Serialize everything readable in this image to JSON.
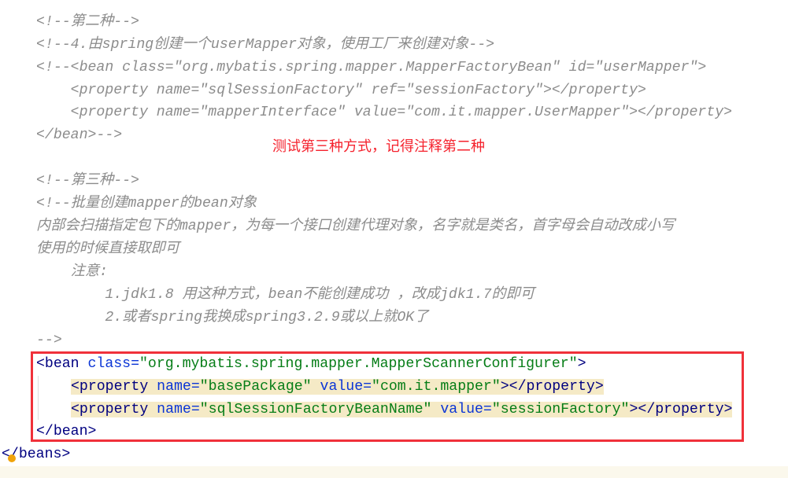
{
  "comment_lines": [
    "<!--第二种-->",
    "<!--4.由spring创建一个userMapper对象，使用工厂来创建对象-->",
    "<!--<bean class=\"org.mybatis.spring.mapper.MapperFactoryBean\" id=\"userMapper\">",
    "    <property name=\"sqlSessionFactory\" ref=\"sessionFactory\"></property>",
    "    <property name=\"mapperInterface\" value=\"com.it.mapper.UserMapper\"></property>",
    "</bean>-->",
    "",
    "<!--第三种-->",
    "<!--批量创建mapper的bean对象",
    "内部会扫描指定包下的mapper，为每一个接口创建代理对象，名字就是类名，首字母会自动改成小写",
    "使用的时候直接取即可",
    "    注意:",
    "        1.jdk1.8 用这种方式，bean不能创建成功 ，改成jdk1.7的即可",
    "        2.或者spring我换成spring3.2.9或以上就OK了",
    "-->"
  ],
  "annotation": "测试第三种方式，记得注释第二种",
  "bean": {
    "open": "<bean",
    "class_attr": "class=",
    "class_val": "\"org.mybatis.spring.mapper.MapperScannerConfigurer\"",
    "close_open": ">",
    "properties": [
      {
        "name_val": "\"basePackage\"",
        "value_val": "\"com.it.mapper\""
      },
      {
        "name_val": "\"sqlSessionFactoryBeanName\"",
        "value_val": "\"sessionFactory\""
      }
    ],
    "prop_open": "<property",
    "name_attr": "name=",
    "value_attr": "value=",
    "prop_close": "></property>",
    "end": "</bean>"
  },
  "beans_end": "</beans>",
  "colors": {
    "highlight_box": "#f0313a",
    "annotation": "#f5222d"
  }
}
